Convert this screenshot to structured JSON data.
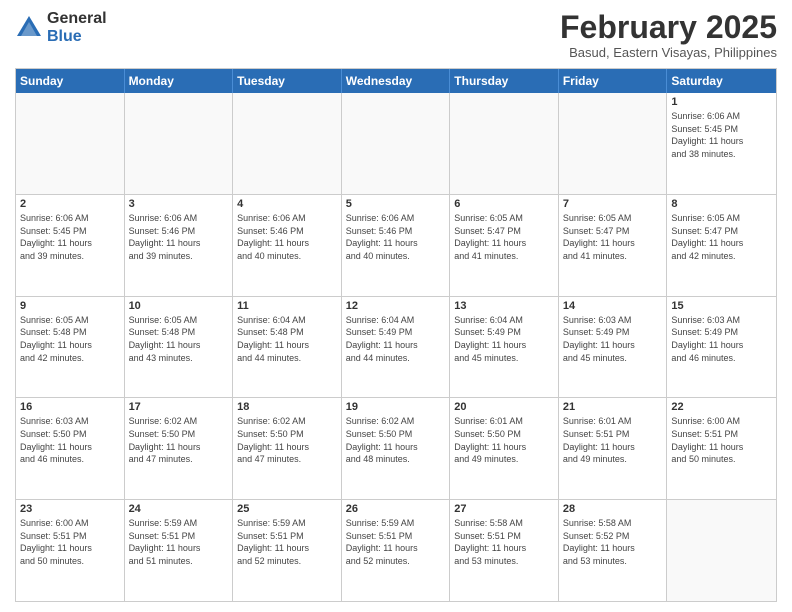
{
  "logo": {
    "general": "General",
    "blue": "Blue"
  },
  "title": "February 2025",
  "location": "Basud, Eastern Visayas, Philippines",
  "days": [
    "Sunday",
    "Monday",
    "Tuesday",
    "Wednesday",
    "Thursday",
    "Friday",
    "Saturday"
  ],
  "weeks": [
    [
      {
        "day": "",
        "info": ""
      },
      {
        "day": "",
        "info": ""
      },
      {
        "day": "",
        "info": ""
      },
      {
        "day": "",
        "info": ""
      },
      {
        "day": "",
        "info": ""
      },
      {
        "day": "",
        "info": ""
      },
      {
        "day": "1",
        "info": "Sunrise: 6:06 AM\nSunset: 5:45 PM\nDaylight: 11 hours\nand 38 minutes."
      }
    ],
    [
      {
        "day": "2",
        "info": "Sunrise: 6:06 AM\nSunset: 5:45 PM\nDaylight: 11 hours\nand 39 minutes."
      },
      {
        "day": "3",
        "info": "Sunrise: 6:06 AM\nSunset: 5:46 PM\nDaylight: 11 hours\nand 39 minutes."
      },
      {
        "day": "4",
        "info": "Sunrise: 6:06 AM\nSunset: 5:46 PM\nDaylight: 11 hours\nand 40 minutes."
      },
      {
        "day": "5",
        "info": "Sunrise: 6:06 AM\nSunset: 5:46 PM\nDaylight: 11 hours\nand 40 minutes."
      },
      {
        "day": "6",
        "info": "Sunrise: 6:05 AM\nSunset: 5:47 PM\nDaylight: 11 hours\nand 41 minutes."
      },
      {
        "day": "7",
        "info": "Sunrise: 6:05 AM\nSunset: 5:47 PM\nDaylight: 11 hours\nand 41 minutes."
      },
      {
        "day": "8",
        "info": "Sunrise: 6:05 AM\nSunset: 5:47 PM\nDaylight: 11 hours\nand 42 minutes."
      }
    ],
    [
      {
        "day": "9",
        "info": "Sunrise: 6:05 AM\nSunset: 5:48 PM\nDaylight: 11 hours\nand 42 minutes."
      },
      {
        "day": "10",
        "info": "Sunrise: 6:05 AM\nSunset: 5:48 PM\nDaylight: 11 hours\nand 43 minutes."
      },
      {
        "day": "11",
        "info": "Sunrise: 6:04 AM\nSunset: 5:48 PM\nDaylight: 11 hours\nand 44 minutes."
      },
      {
        "day": "12",
        "info": "Sunrise: 6:04 AM\nSunset: 5:49 PM\nDaylight: 11 hours\nand 44 minutes."
      },
      {
        "day": "13",
        "info": "Sunrise: 6:04 AM\nSunset: 5:49 PM\nDaylight: 11 hours\nand 45 minutes."
      },
      {
        "day": "14",
        "info": "Sunrise: 6:03 AM\nSunset: 5:49 PM\nDaylight: 11 hours\nand 45 minutes."
      },
      {
        "day": "15",
        "info": "Sunrise: 6:03 AM\nSunset: 5:49 PM\nDaylight: 11 hours\nand 46 minutes."
      }
    ],
    [
      {
        "day": "16",
        "info": "Sunrise: 6:03 AM\nSunset: 5:50 PM\nDaylight: 11 hours\nand 46 minutes."
      },
      {
        "day": "17",
        "info": "Sunrise: 6:02 AM\nSunset: 5:50 PM\nDaylight: 11 hours\nand 47 minutes."
      },
      {
        "day": "18",
        "info": "Sunrise: 6:02 AM\nSunset: 5:50 PM\nDaylight: 11 hours\nand 47 minutes."
      },
      {
        "day": "19",
        "info": "Sunrise: 6:02 AM\nSunset: 5:50 PM\nDaylight: 11 hours\nand 48 minutes."
      },
      {
        "day": "20",
        "info": "Sunrise: 6:01 AM\nSunset: 5:50 PM\nDaylight: 11 hours\nand 49 minutes."
      },
      {
        "day": "21",
        "info": "Sunrise: 6:01 AM\nSunset: 5:51 PM\nDaylight: 11 hours\nand 49 minutes."
      },
      {
        "day": "22",
        "info": "Sunrise: 6:00 AM\nSunset: 5:51 PM\nDaylight: 11 hours\nand 50 minutes."
      }
    ],
    [
      {
        "day": "23",
        "info": "Sunrise: 6:00 AM\nSunset: 5:51 PM\nDaylight: 11 hours\nand 50 minutes."
      },
      {
        "day": "24",
        "info": "Sunrise: 5:59 AM\nSunset: 5:51 PM\nDaylight: 11 hours\nand 51 minutes."
      },
      {
        "day": "25",
        "info": "Sunrise: 5:59 AM\nSunset: 5:51 PM\nDaylight: 11 hours\nand 52 minutes."
      },
      {
        "day": "26",
        "info": "Sunrise: 5:59 AM\nSunset: 5:51 PM\nDaylight: 11 hours\nand 52 minutes."
      },
      {
        "day": "27",
        "info": "Sunrise: 5:58 AM\nSunset: 5:51 PM\nDaylight: 11 hours\nand 53 minutes."
      },
      {
        "day": "28",
        "info": "Sunrise: 5:58 AM\nSunset: 5:52 PM\nDaylight: 11 hours\nand 53 minutes."
      },
      {
        "day": "",
        "info": ""
      }
    ]
  ]
}
